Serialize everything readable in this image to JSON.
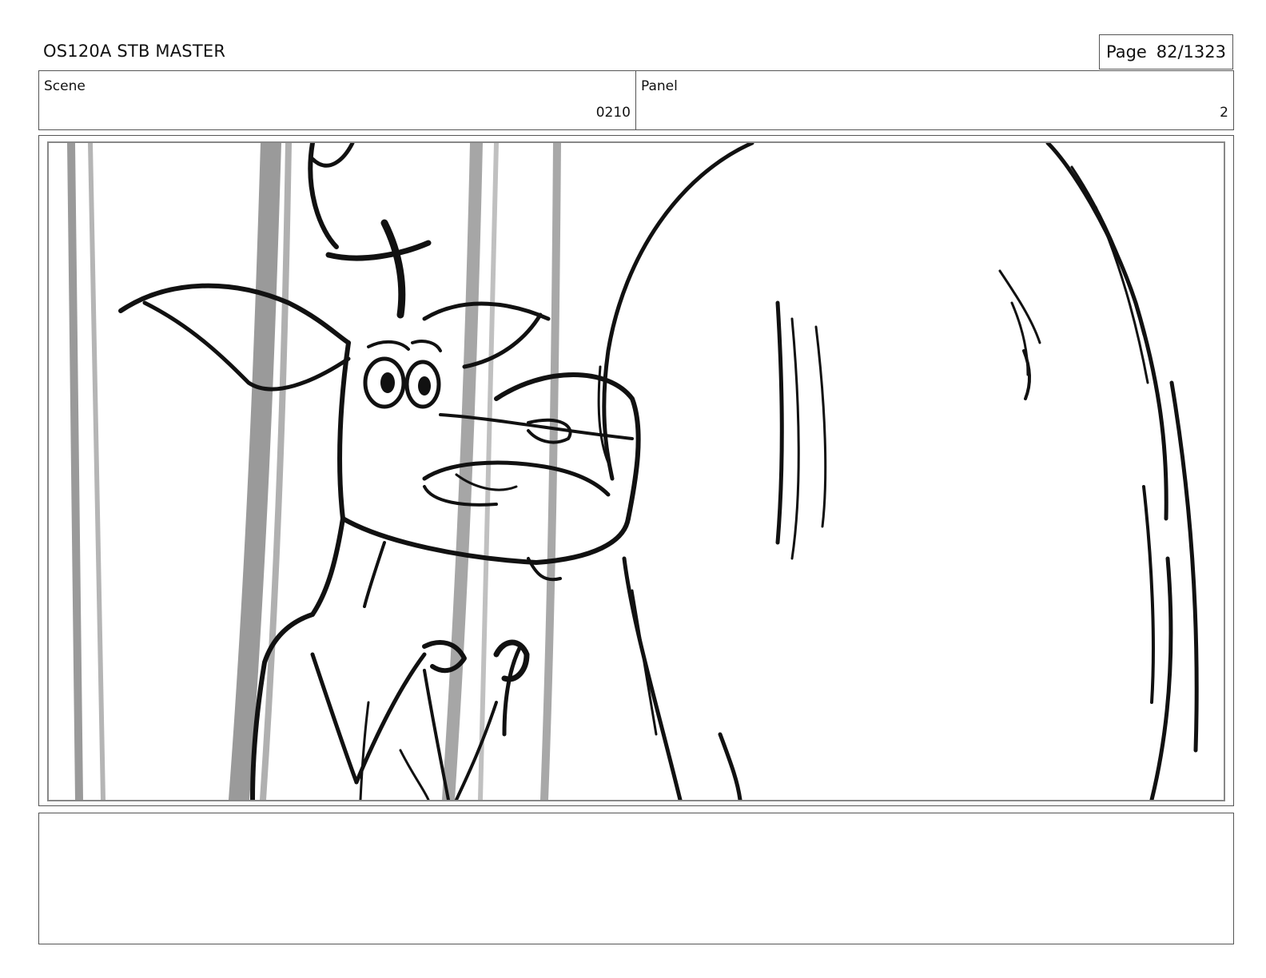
{
  "header": {
    "title": "OS120A STB MASTER",
    "page_label": "Page",
    "page_value": "82/1323"
  },
  "info": {
    "scene_label": "Scene",
    "scene_value": "0210",
    "panel_label": "Panel",
    "panel_value": "2"
  },
  "notes": {
    "text": ""
  }
}
